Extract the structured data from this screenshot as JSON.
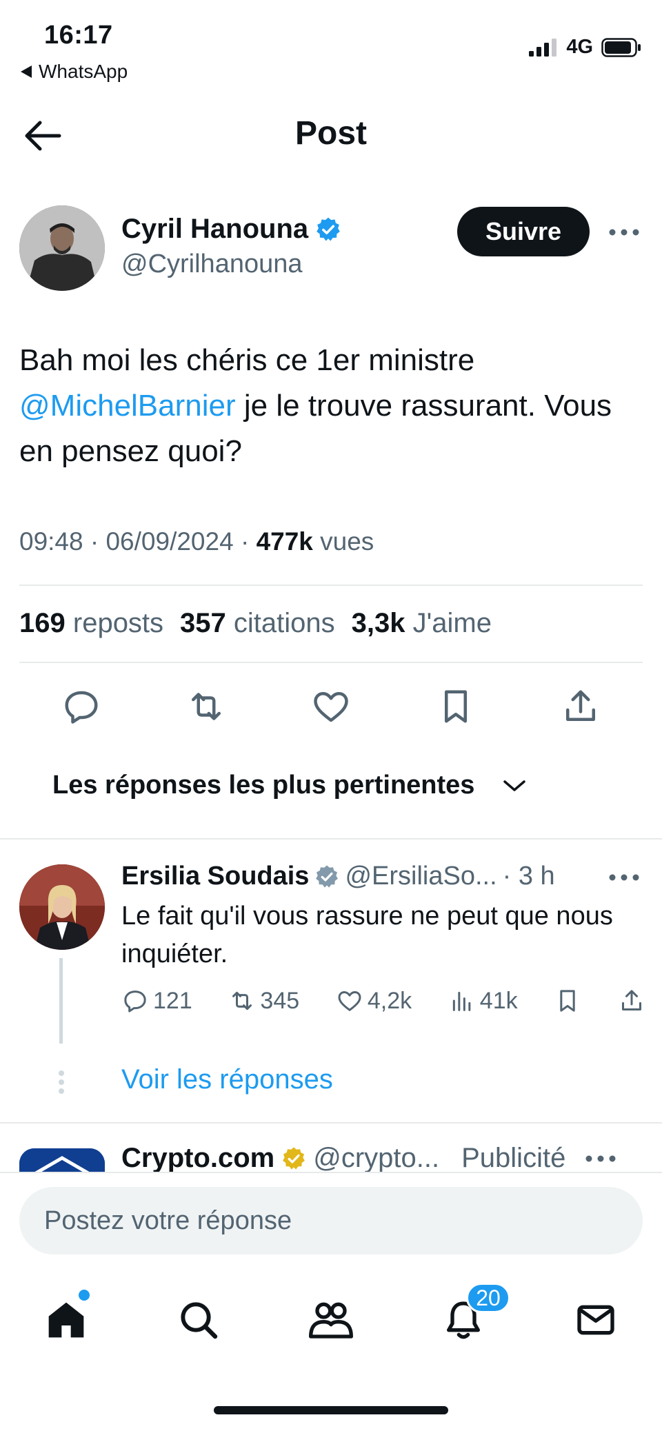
{
  "status_bar": {
    "time": "16:17",
    "back_app": "WhatsApp",
    "network": "4G"
  },
  "nav": {
    "title": "Post"
  },
  "author": {
    "name": "Cyril Hanouna",
    "handle": "@Cyrilhanouna",
    "follow_label": "Suivre"
  },
  "post": {
    "text_before": "Bah moi les chéris ce 1er ministre ",
    "mention": "@MichelBarnier",
    "text_after": " je le trouve rassurant. Vous en pensez quoi?",
    "time": "09:48",
    "date": "06/09/2024",
    "views_count": "477k",
    "views_label": "vues",
    "separator": "·"
  },
  "stats": {
    "reposts_count": "169",
    "reposts_label": "reposts",
    "quotes_count": "357",
    "quotes_label": "citations",
    "likes_count": "3,3k",
    "likes_label": "J'aime"
  },
  "sort": {
    "label": "Les réponses les plus pertinentes"
  },
  "reply": {
    "name": "Ersilia Soudais",
    "handle": "@ErsiliaSo...",
    "time": "· 3 h",
    "text": "Le fait qu'il vous rassure ne peut que nous inquiéter.",
    "replies": "121",
    "reposts": "345",
    "likes": "4,2k",
    "views": "41k",
    "see_replies": "Voir les réponses"
  },
  "ad": {
    "name": "Crypto.com",
    "handle": "@crypto...",
    "label": "Publicité"
  },
  "composer": {
    "placeholder": "Postez votre réponse"
  },
  "tabbar": {
    "notifications_badge": "20"
  },
  "colors": {
    "accent": "#1d9bf0",
    "text": "#0f1419",
    "muted": "#536471",
    "gold_badge": "#e2b719"
  }
}
